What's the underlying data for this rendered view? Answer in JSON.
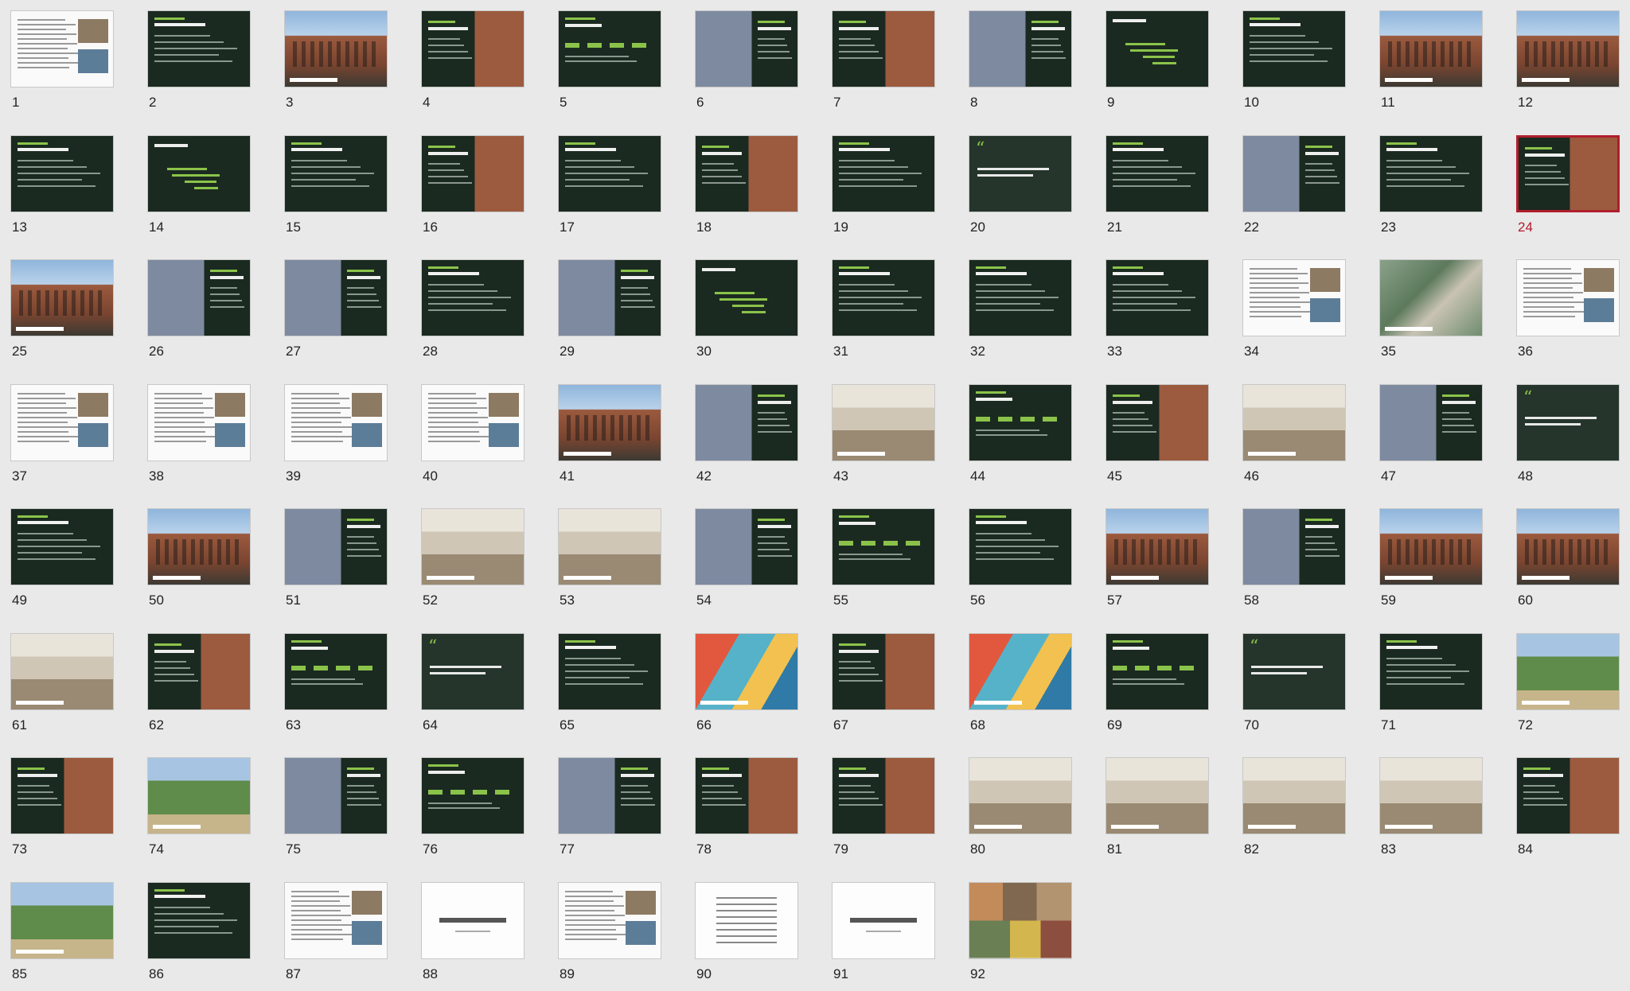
{
  "panel": "slide-thumbnails",
  "selected_slide": "24",
  "slides": [
    {
      "n": "1",
      "kind": "white"
    },
    {
      "n": "2",
      "kind": "dark"
    },
    {
      "n": "3",
      "kind": "photo"
    },
    {
      "n": "4",
      "kind": "splitR"
    },
    {
      "n": "5",
      "kind": "stat"
    },
    {
      "n": "6",
      "kind": "splitL"
    },
    {
      "n": "7",
      "kind": "splitR"
    },
    {
      "n": "8",
      "kind": "splitL"
    },
    {
      "n": "9",
      "kind": "chart"
    },
    {
      "n": "10",
      "kind": "dark"
    },
    {
      "n": "11",
      "kind": "photo"
    },
    {
      "n": "12",
      "kind": "photo"
    },
    {
      "n": "13",
      "kind": "dark"
    },
    {
      "n": "14",
      "kind": "chart"
    },
    {
      "n": "15",
      "kind": "dark"
    },
    {
      "n": "16",
      "kind": "splitR"
    },
    {
      "n": "17",
      "kind": "dark"
    },
    {
      "n": "18",
      "kind": "splitR"
    },
    {
      "n": "19",
      "kind": "dark"
    },
    {
      "n": "20",
      "kind": "quote"
    },
    {
      "n": "21",
      "kind": "dark"
    },
    {
      "n": "22",
      "kind": "splitL"
    },
    {
      "n": "23",
      "kind": "dark"
    },
    {
      "n": "24",
      "kind": "splitR"
    },
    {
      "n": "25",
      "kind": "photo"
    },
    {
      "n": "26",
      "kind": "splitL"
    },
    {
      "n": "27",
      "kind": "splitL"
    },
    {
      "n": "28",
      "kind": "dark"
    },
    {
      "n": "29",
      "kind": "splitL"
    },
    {
      "n": "30",
      "kind": "chart"
    },
    {
      "n": "31",
      "kind": "dark"
    },
    {
      "n": "32",
      "kind": "dark"
    },
    {
      "n": "33",
      "kind": "dark"
    },
    {
      "n": "34",
      "kind": "white"
    },
    {
      "n": "35",
      "kind": "aerial"
    },
    {
      "n": "36",
      "kind": "white"
    },
    {
      "n": "37",
      "kind": "white"
    },
    {
      "n": "38",
      "kind": "white"
    },
    {
      "n": "39",
      "kind": "white"
    },
    {
      "n": "40",
      "kind": "white"
    },
    {
      "n": "41",
      "kind": "photo"
    },
    {
      "n": "42",
      "kind": "splitL"
    },
    {
      "n": "43",
      "kind": "interior"
    },
    {
      "n": "44",
      "kind": "stat"
    },
    {
      "n": "45",
      "kind": "splitR"
    },
    {
      "n": "46",
      "kind": "interior"
    },
    {
      "n": "47",
      "kind": "splitL"
    },
    {
      "n": "48",
      "kind": "quote"
    },
    {
      "n": "49",
      "kind": "dark"
    },
    {
      "n": "50",
      "kind": "photo"
    },
    {
      "n": "51",
      "kind": "splitL"
    },
    {
      "n": "52",
      "kind": "interior"
    },
    {
      "n": "53",
      "kind": "interior"
    },
    {
      "n": "54",
      "kind": "splitL"
    },
    {
      "n": "55",
      "kind": "stat"
    },
    {
      "n": "56",
      "kind": "dark"
    },
    {
      "n": "57",
      "kind": "photo"
    },
    {
      "n": "58",
      "kind": "splitL"
    },
    {
      "n": "59",
      "kind": "photo"
    },
    {
      "n": "60",
      "kind": "photo"
    },
    {
      "n": "61",
      "kind": "interior"
    },
    {
      "n": "62",
      "kind": "splitR"
    },
    {
      "n": "63",
      "kind": "stat"
    },
    {
      "n": "64",
      "kind": "quote"
    },
    {
      "n": "65",
      "kind": "dark"
    },
    {
      "n": "66",
      "kind": "mural"
    },
    {
      "n": "67",
      "kind": "splitR"
    },
    {
      "n": "68",
      "kind": "mural"
    },
    {
      "n": "69",
      "kind": "stat"
    },
    {
      "n": "70",
      "kind": "quote"
    },
    {
      "n": "71",
      "kind": "dark"
    },
    {
      "n": "72",
      "kind": "green"
    },
    {
      "n": "73",
      "kind": "splitR"
    },
    {
      "n": "74",
      "kind": "green"
    },
    {
      "n": "75",
      "kind": "splitL"
    },
    {
      "n": "76",
      "kind": "stat"
    },
    {
      "n": "77",
      "kind": "splitL"
    },
    {
      "n": "78",
      "kind": "splitR"
    },
    {
      "n": "79",
      "kind": "splitR"
    },
    {
      "n": "80",
      "kind": "interior"
    },
    {
      "n": "81",
      "kind": "interior"
    },
    {
      "n": "82",
      "kind": "interior"
    },
    {
      "n": "83",
      "kind": "interior"
    },
    {
      "n": "84",
      "kind": "splitR"
    },
    {
      "n": "85",
      "kind": "green"
    },
    {
      "n": "86",
      "kind": "dark"
    },
    {
      "n": "87",
      "kind": "white"
    },
    {
      "n": "88",
      "kind": "title"
    },
    {
      "n": "89",
      "kind": "white"
    },
    {
      "n": "90",
      "kind": "doc"
    },
    {
      "n": "91",
      "kind": "title"
    },
    {
      "n": "92",
      "kind": "collage"
    }
  ]
}
